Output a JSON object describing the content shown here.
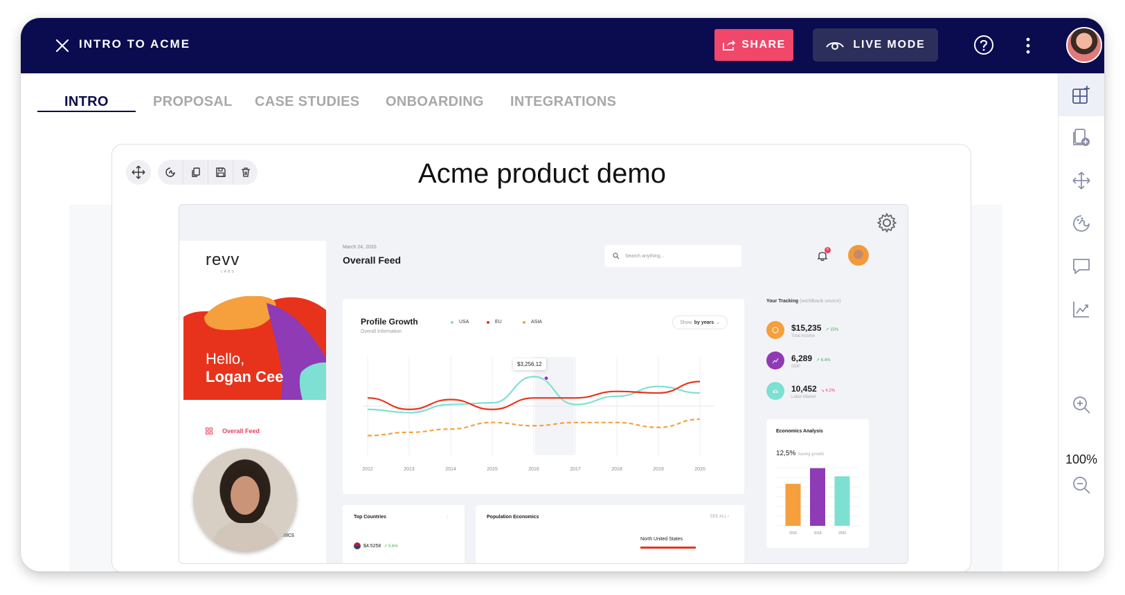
{
  "topbar": {
    "title": "INTRO TO ACME",
    "share_label": "SHARE",
    "live_mode_label": "LIVE MODE"
  },
  "tabs": [
    {
      "label": "INTRO",
      "active": true
    },
    {
      "label": "PROPOSAL",
      "active": false
    },
    {
      "label": "CASE STUDIES",
      "active": false
    },
    {
      "label": "ONBOARDING",
      "active": false
    },
    {
      "label": "INTEGRATIONS",
      "active": false
    }
  ],
  "rail": {
    "icons": [
      "add-block-icon",
      "add-page-icon",
      "move-icon",
      "palette-icon",
      "comment-icon",
      "analytics-icon",
      "zoom-in-icon",
      "zoom-out-icon"
    ],
    "zoom": "100%"
  },
  "card": {
    "title": "Acme product demo",
    "tools": [
      "move-icon",
      "style-icon",
      "duplicate-icon",
      "save-icon",
      "delete-icon"
    ]
  },
  "dashboard": {
    "brand": "revv",
    "brand_sub": "LABS",
    "hello_line1": "Hello,",
    "hello_line2": "Logan Cee",
    "nav_active": "Overall Feed",
    "nav_partial": "conomics",
    "date": "March 24, 2020",
    "feed_title": "Overall Feed",
    "search_placeholder": "Search anything...",
    "notification_count": "6",
    "profile_growth": {
      "title": "Profile Growth",
      "subtitle": "Overall Information",
      "show_by_prefix": "Show",
      "show_by_value": "by years",
      "tooltip": "$3,256.12"
    },
    "tracking": {
      "title": "Your Tracking",
      "source": "(worldbank source)",
      "items": [
        {
          "value": "$15,235",
          "delta": "15%",
          "label": "Total Income",
          "color": "#f5a03c",
          "trend": "up"
        },
        {
          "value": "6,289",
          "delta": "6.4%",
          "label": "GDP",
          "color": "#8e3bb5",
          "trend": "up"
        },
        {
          "value": "10,452",
          "delta": "4.2%",
          "label": "Labor Market",
          "color": "#7de0d2",
          "trend": "down"
        }
      ]
    },
    "economics": {
      "title": "Economics Analysis",
      "value": "12,5%",
      "value_label": "Saving growth"
    },
    "top_countries": {
      "title": "Top Countries",
      "first_value": "$4.5258",
      "first_delta": "5.6%"
    },
    "population": {
      "title": "Population Economics",
      "see_all": "SEE ALL",
      "label": "North United States"
    }
  },
  "chart_data": [
    {
      "type": "line",
      "title": "Profile Growth",
      "x": [
        "2012",
        "2013",
        "2014",
        "2015",
        "2016",
        "2017",
        "2018",
        "2019",
        "2020"
      ],
      "series": [
        {
          "name": "USA",
          "color": "#7de0d2",
          "values": [
            38,
            36,
            41,
            42,
            58,
            41,
            46,
            52,
            48
          ]
        },
        {
          "name": "EU",
          "color": "#e8331c",
          "values": [
            45,
            38,
            44,
            38,
            45,
            45,
            49,
            48,
            55
          ]
        },
        {
          "name": "ASIA",
          "color": "#f5a03c",
          "values": [
            22,
            24,
            26,
            30,
            28,
            30,
            30,
            27,
            32
          ]
        }
      ]
    },
    {
      "type": "bar",
      "title": "Economics Analysis",
      "categories": [
        "2016",
        "2018",
        "2020"
      ],
      "values": [
        62,
        85,
        73
      ],
      "colors": [
        "#f5a03c",
        "#8e3bb5",
        "#7de0d2"
      ]
    }
  ]
}
